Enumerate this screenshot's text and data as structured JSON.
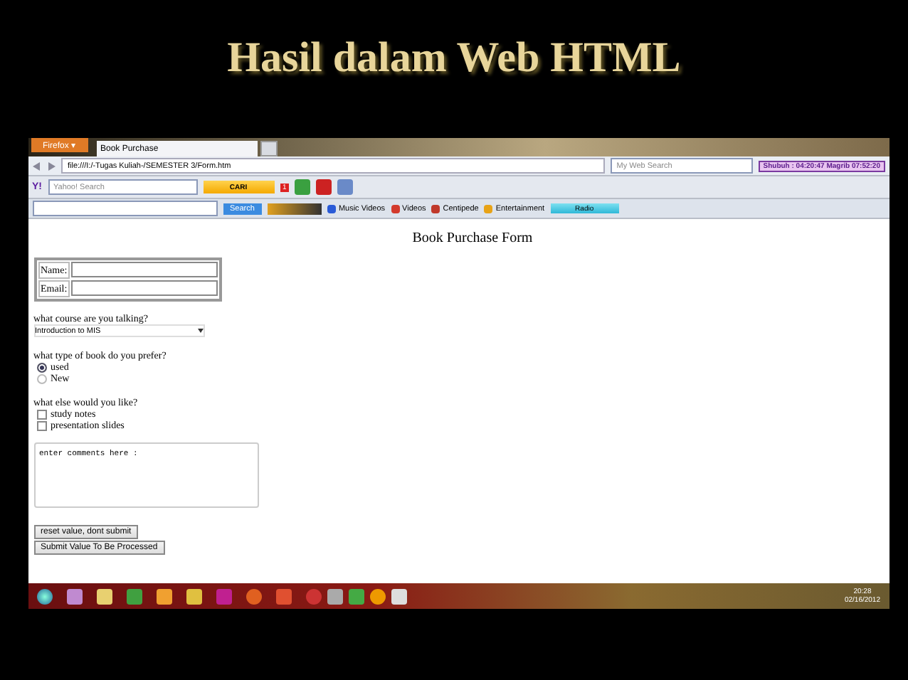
{
  "slide_title": "Hasil dalam Web HTML",
  "browser": {
    "app_button": "Firefox ▾",
    "tab": {
      "label": "Book Purchase",
      "selected": true
    },
    "url": "file:///I:/-Tugas Kuliah-/SEMESTER 3/Form.htm",
    "search_placeholder": "My Web Search",
    "prayer_times": "Shubuh : 04:20:47  Magrib 07:52:20"
  },
  "yahoo_toolbar": {
    "logo": "Y!",
    "search_placeholder": "Yahoo! Search",
    "button": "CARI",
    "badge": "1"
  },
  "links_toolbar": {
    "search_button": "Search",
    "items": [
      {
        "label": "Music Videos",
        "color": "#2a5bd7"
      },
      {
        "label": "Videos",
        "color": "#d33a2c"
      },
      {
        "label": "Centipede",
        "color": "#c0392b"
      },
      {
        "label": "Entertainment",
        "color": "#e8a317"
      }
    ],
    "radio": "Radio"
  },
  "page": {
    "heading": "Book Purchase Form",
    "fields": [
      {
        "label": "Name:"
      },
      {
        "label": "Email:"
      }
    ],
    "course_question": "what course are you talking?",
    "course_value": "Introduction to MIS",
    "type_question": "what type of book do you prefer?",
    "types": [
      {
        "label": "used",
        "selected": true
      },
      {
        "label": "New",
        "selected": false
      }
    ],
    "extras_question": "what else would you like?",
    "extras": [
      {
        "label": "study notes",
        "checked": false
      },
      {
        "label": "presentation slides",
        "checked": false
      }
    ],
    "comments": "enter comments here :",
    "buttons": [
      "reset value, dont submit",
      "Submit Value To Be Processed"
    ]
  },
  "taskbar": {
    "time": "20:28",
    "date": "02/16/2012"
  }
}
